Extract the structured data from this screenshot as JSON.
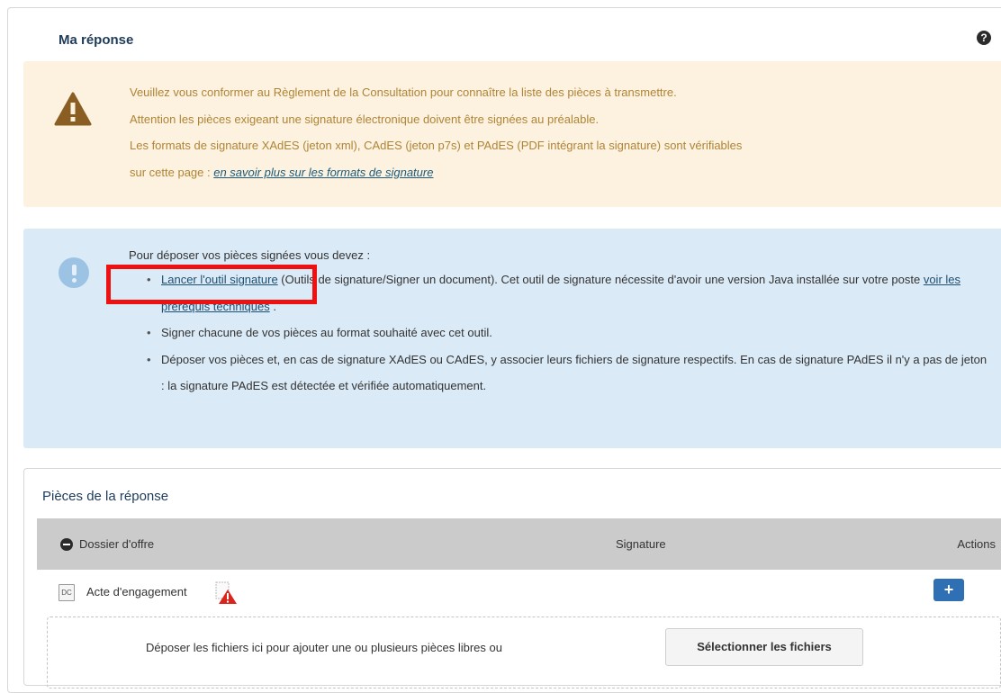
{
  "header": {
    "title": "Ma réponse",
    "help_icon": "?"
  },
  "warning": {
    "line1": "Veuillez vous conformer au Règlement de la Consultation pour connaître la liste des pièces à transmettre.",
    "line2": "Attention les pièces exigeant une signature électronique doivent être signées au préalable.",
    "line3": "Les formats de signature XAdES (jeton xml), CAdES (jeton p7s) et PAdES (PDF intégrant la signature) sont vérifiables",
    "line4_prefix": "sur cette page : ",
    "line4_link": "en savoir plus sur les formats de signature",
    "color": "#b08436",
    "background": "#fcf2df"
  },
  "info": {
    "intro": "Pour déposer vos pièces signées vous devez :",
    "item1_link": "Lancer l'outil signature",
    "item1_rest": " (Outils de signature/Signer un document). Cet outil de signature nécessite d'avoir une version Java installée sur votre poste ",
    "item1_link2": "voir les prérequis techniques",
    "item1_end": " .",
    "item2": "Signer chacune de vos pièces au format souhaité avec cet outil.",
    "item3": "Déposer vos pièces et, en cas de signature XAdES ou CAdES, y associer leurs fichiers de signature respectifs. En cas de signature PAdES il n'y a pas de jeton : la signature PAdES est détectée et vérifiée automatiquement.",
    "background": "#daeaf6"
  },
  "pieces": {
    "title": "Pièces de la réponse",
    "columns": {
      "dossier": "Dossier d'offre",
      "signature": "Signature",
      "actions": "Actions"
    },
    "rows": [
      {
        "icon": "DC",
        "label": "Acte d'engagement",
        "add_label": "+"
      }
    ],
    "dropzone_text": "Déposer les fichiers ici pour ajouter une ou plusieurs pièces libres ou",
    "select_button": "Sélectionner les fichiers"
  },
  "colors": {
    "accent": "#2f6fb3",
    "highlight": "#ee1111"
  }
}
